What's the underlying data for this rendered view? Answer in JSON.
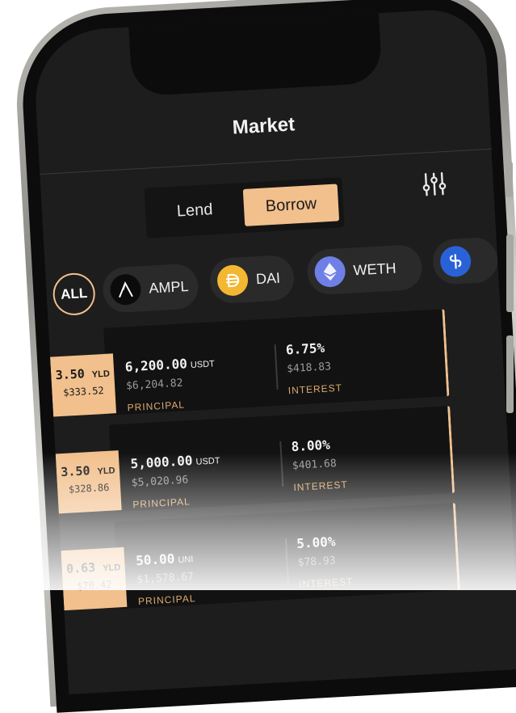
{
  "header": {
    "title": "Market"
  },
  "tabs": [
    {
      "label": "Lend",
      "active": false
    },
    {
      "label": "Borrow",
      "active": true
    }
  ],
  "filter_icon": "sliders-icon",
  "assets": [
    {
      "label": "ALL",
      "icon": "",
      "selected": true
    },
    {
      "label": "AMPL",
      "icon": "ampl-token-icon"
    },
    {
      "label": "DAI",
      "icon": "dai-token-icon"
    },
    {
      "label": "WETH",
      "icon": "weth-token-icon"
    },
    {
      "label": "",
      "icon": "usdt-token-icon"
    }
  ],
  "rows": [
    {
      "yld": "3.50",
      "yld_unit": "YLD",
      "yld_usd": "$333.52",
      "principal": "6,200.00",
      "principal_unit": "USDT",
      "principal_usd": "$6,204.82",
      "principal_label": "PRINCIPAL",
      "interest": "6.75%",
      "interest_usd": "$418.83",
      "interest_label": "INTEREST"
    },
    {
      "yld": "3.50",
      "yld_unit": "YLD",
      "yld_usd": "$328.86",
      "principal": "5,000.00",
      "principal_unit": "USDT",
      "principal_usd": "$5,020.96",
      "principal_label": "PRINCIPAL",
      "interest": "8.00%",
      "interest_usd": "$401.68",
      "interest_label": "INTEREST"
    },
    {
      "yld": "0.63",
      "yld_unit": "YLD",
      "yld_usd": "$70.42",
      "principal": "50.00",
      "principal_unit": "UNI",
      "principal_usd": "$1,578.67",
      "principal_label": "PRINCIPAL",
      "interest": "5.00%",
      "interest_usd": "$78.93",
      "interest_label": "INTEREST"
    }
  ],
  "colors": {
    "accent": "#f2c08d",
    "background": "#1d1d1d",
    "card": "#121212"
  }
}
